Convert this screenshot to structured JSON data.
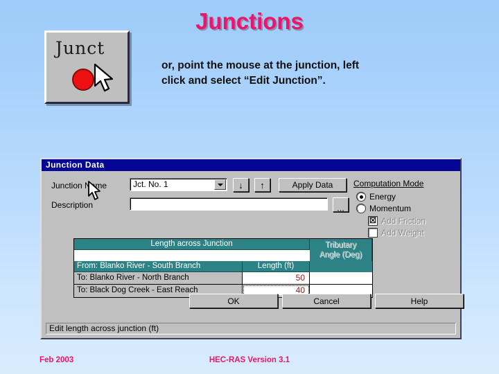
{
  "slide": {
    "title": "Junctions",
    "body_line1": "or, point the mouse at the junction, left",
    "body_line2": "click and select “Edit Junction”.",
    "icon_label": "Junct",
    "footer_date": "Feb 2003",
    "footer_version": "HEC-RAS Version 3.1",
    "accent_color": "#e8166c",
    "background_top": "#9ecbfa",
    "background_bottom": "#d9ecfe"
  },
  "dialog": {
    "title": "Junction Data",
    "junction_name_label": "Junction Name",
    "junction_name_value": "Jct. No. 1",
    "down_arrow_glyph": "↓",
    "up_arrow_glyph": "↑",
    "apply_data_label": "Apply Data",
    "description_label": "Description",
    "description_value": "",
    "description_placeholder": "",
    "browse_label": "...",
    "computation_mode": {
      "group_label": "Computation Mode",
      "options": [
        {
          "label": "Energy",
          "selected": true
        },
        {
          "label": "Momentum",
          "selected": false
        }
      ],
      "checkboxes": [
        {
          "label": "Add Friction",
          "checked": true,
          "glyph": "☒",
          "enabled": false
        },
        {
          "label": "Add Weight",
          "checked": false,
          "glyph": "",
          "enabled": false
        }
      ]
    },
    "table": {
      "span_header": "Length across Junction",
      "angle_header_line1": "Tributary",
      "angle_header_line2": "Angle (Deg)",
      "col_from_header": "From: Blanko River - South Branch",
      "col_length_header": "Length (ft)",
      "rows": [
        {
          "name": "To: Blanko River - North Branch",
          "length": "50",
          "angle": "",
          "focused": false
        },
        {
          "name": "To: Black Dog Creek - East Reach",
          "length": "40",
          "angle": "",
          "focused": true
        }
      ]
    },
    "buttons": {
      "ok": "OK",
      "cancel": "Cancel",
      "help": "Help"
    },
    "status_text": "Edit length across junction (ft)"
  }
}
